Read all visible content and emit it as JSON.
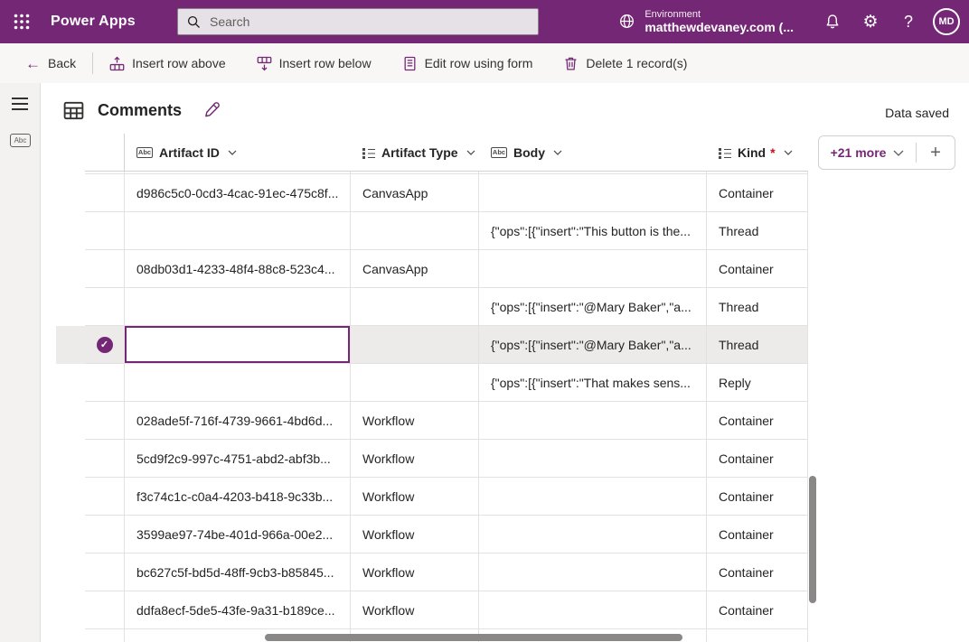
{
  "header": {
    "app_name": "Power Apps",
    "search_placeholder": "Search",
    "environment_label": "Environment",
    "environment_name": "matthewdevaney.com (...",
    "avatar_initials": "MD",
    "gear_glyph": "⚙",
    "help_glyph": "?",
    "brand_color": "#742774"
  },
  "toolbar": {
    "back_glyph": "←",
    "back_label": "Back",
    "actions": [
      {
        "label": "Insert row above",
        "icon": "insert-row-above-icon"
      },
      {
        "label": "Insert row below",
        "icon": "insert-row-below-icon"
      },
      {
        "label": "Edit row using form",
        "icon": "edit-form-icon"
      },
      {
        "label": "Delete 1 record(s)",
        "icon": "delete-icon"
      }
    ]
  },
  "sidebar": {
    "icons": [
      "menu-icon",
      "abc-field-icon"
    ]
  },
  "main": {
    "title": "Comments",
    "status": "Data saved",
    "more_columns": "+21 more",
    "add_column_glyph": "+"
  },
  "grid": {
    "columns": [
      {
        "label": "Artifact ID",
        "type_icon": "abc",
        "required_marker": ""
      },
      {
        "label": "Artifact Type",
        "type_icon": "list",
        "required_marker": ""
      },
      {
        "label": "Body",
        "type_icon": "abc",
        "required_marker": ""
      },
      {
        "label": "Kind",
        "type_icon": "list",
        "required_marker": "*"
      }
    ],
    "rows": [
      {
        "artifact_id": "d986c5c0-0cd3-4cac-91ec-475c8f...",
        "artifact_type": "CanvasApp",
        "body": "",
        "kind": "Container",
        "selected": false
      },
      {
        "artifact_id": "",
        "artifact_type": "",
        "body": "{\"ops\":[{\"insert\":\"This button is the...",
        "kind": "Thread",
        "selected": false
      },
      {
        "artifact_id": "08db03d1-4233-48f4-88c8-523c4...",
        "artifact_type": "CanvasApp",
        "body": "",
        "kind": "Container",
        "selected": false
      },
      {
        "artifact_id": "",
        "artifact_type": "",
        "body": "{\"ops\":[{\"insert\":\"@Mary Baker\",\"a...",
        "kind": "Thread",
        "selected": false
      },
      {
        "artifact_id": "",
        "artifact_type": "",
        "body": "{\"ops\":[{\"insert\":\"@Mary Baker\",\"a...",
        "kind": "Thread",
        "selected": true
      },
      {
        "artifact_id": "",
        "artifact_type": "",
        "body": "{\"ops\":[{\"insert\":\"That makes sens...",
        "kind": "Reply",
        "selected": false
      },
      {
        "artifact_id": "028ade5f-716f-4739-9661-4bd6d...",
        "artifact_type": "Workflow",
        "body": "",
        "kind": "Container",
        "selected": false
      },
      {
        "artifact_id": "5cd9f2c9-997c-4751-abd2-abf3b...",
        "artifact_type": "Workflow",
        "body": "",
        "kind": "Container",
        "selected": false
      },
      {
        "artifact_id": "f3c74c1c-c0a4-4203-b418-9c33b...",
        "artifact_type": "Workflow",
        "body": "",
        "kind": "Container",
        "selected": false
      },
      {
        "artifact_id": "3599ae97-74be-401d-966a-00e2...",
        "artifact_type": "Workflow",
        "body": "",
        "kind": "Container",
        "selected": false
      },
      {
        "artifact_id": "bc627c5f-bd5d-48ff-9cb3-b85845...",
        "artifact_type": "Workflow",
        "body": "",
        "kind": "Container",
        "selected": false
      },
      {
        "artifact_id": "ddfa8ecf-5de5-43fe-9a31-b189ce...",
        "artifact_type": "Workflow",
        "body": "",
        "kind": "Container",
        "selected": false
      }
    ]
  }
}
